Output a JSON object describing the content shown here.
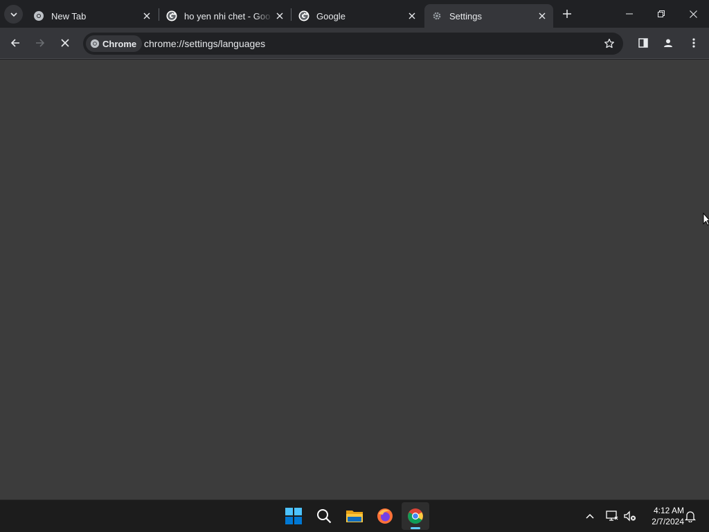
{
  "browser": {
    "tabs": [
      {
        "title": "New Tab",
        "favicon": "chrome-icon",
        "active": false
      },
      {
        "title": "ho yen nhi chet - Goo",
        "favicon": "google-icon",
        "active": false
      },
      {
        "title": "Google",
        "favicon": "google-icon",
        "active": false
      },
      {
        "title": "Settings",
        "favicon": "gear-icon",
        "active": true
      }
    ],
    "omnibox": {
      "chip_label": "Chrome",
      "url": "chrome://settings/languages"
    }
  },
  "taskbar": {
    "apps": [
      "windows-start-icon",
      "search-icon",
      "file-explorer-icon",
      "firefox-icon",
      "chrome-icon"
    ],
    "active_app": "chrome-icon",
    "clock": {
      "time": "4:12 AM",
      "date": "2/7/2024"
    }
  },
  "colors": {
    "tabstrip": "#202124",
    "toolbar": "#35363a",
    "content": "#3c3c3c",
    "taskbar": "#1c1c1c",
    "accent": "#60cdff"
  }
}
